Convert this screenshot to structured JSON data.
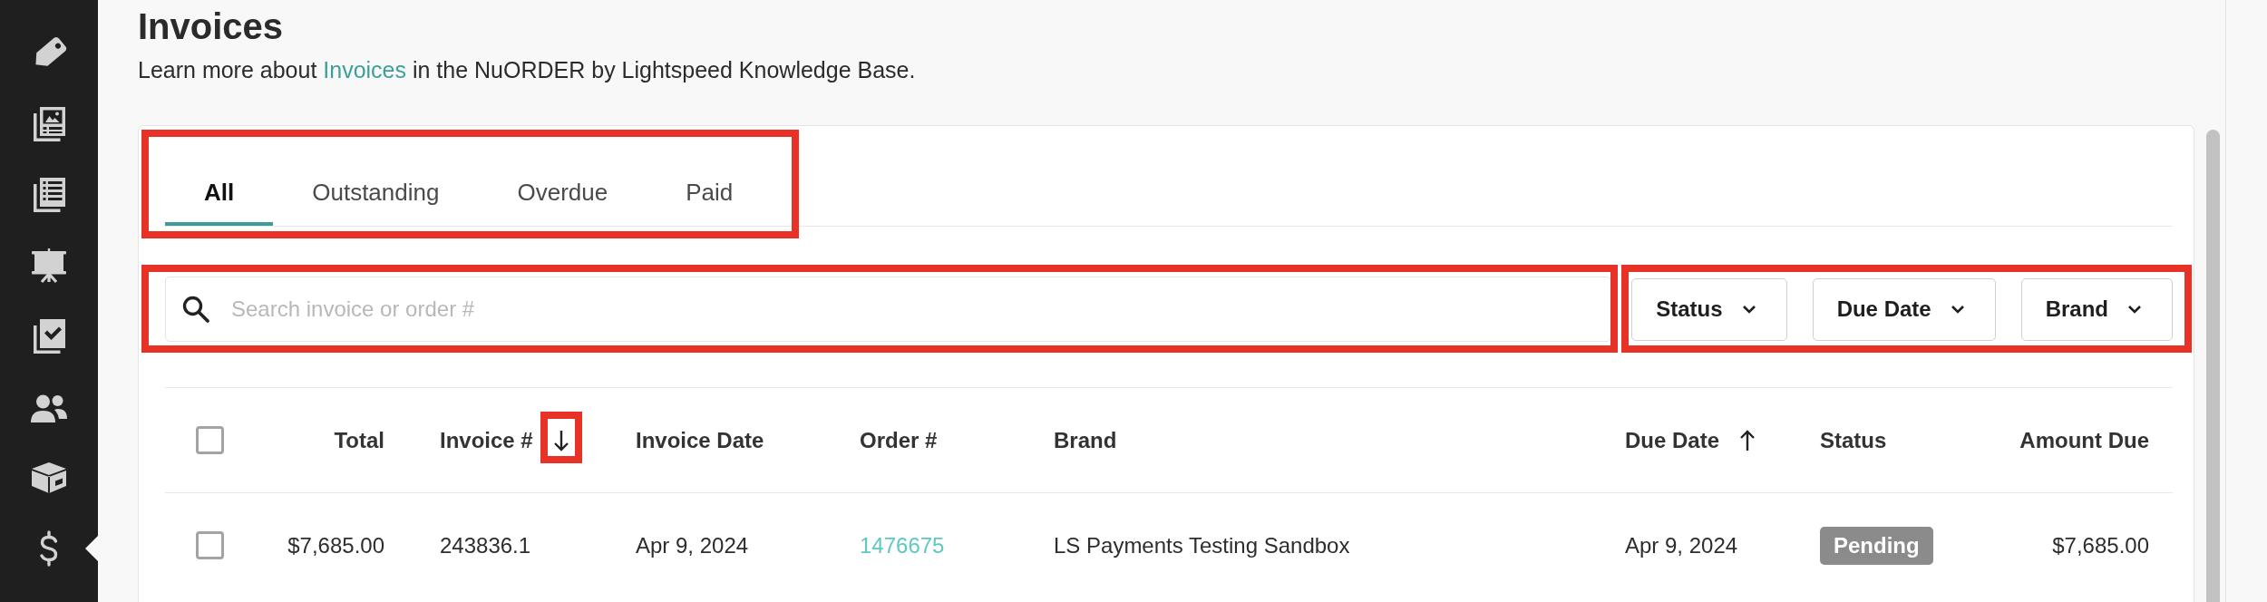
{
  "sidebar": {
    "items": [
      {
        "selected": false
      },
      {
        "selected": false
      },
      {
        "selected": false
      },
      {
        "selected": false
      },
      {
        "selected": false
      },
      {
        "selected": false
      },
      {
        "selected": false
      },
      {
        "selected": true
      }
    ]
  },
  "header": {
    "title": "Invoices",
    "help": {
      "before": "Learn more about ",
      "link": "Invoices",
      "after": " in the NuORDER by Lightspeed Knowledge Base."
    }
  },
  "tabs": {
    "highlighted": true,
    "items": [
      {
        "label": "All",
        "selected": true
      },
      {
        "label": "Outstanding",
        "selected": false
      },
      {
        "label": "Overdue",
        "selected": false
      },
      {
        "label": "Paid",
        "selected": false
      }
    ]
  },
  "search": {
    "placeholder": "Search invoice or order #",
    "highlighted": true
  },
  "filters": {
    "highlighted": true,
    "items": [
      {
        "label": "Status"
      },
      {
        "label": "Due Date"
      },
      {
        "label": "Brand"
      }
    ]
  },
  "table": {
    "select_all": {
      "checked": false
    },
    "columns": [
      {
        "label": "Total",
        "kind": "plain",
        "highlighted": false
      },
      {
        "label": "Invoice #",
        "kind": "descending",
        "highlighted": true
      },
      {
        "label": "Invoice Date",
        "kind": "plain",
        "highlighted": false
      },
      {
        "label": "Order #",
        "kind": "plain",
        "highlighted": false
      },
      {
        "label": "Brand",
        "kind": "plain",
        "highlighted": false
      },
      {
        "label": "Due Date",
        "kind": "ascending",
        "highlighted": false
      },
      {
        "label": "Status",
        "kind": "plain",
        "highlighted": false
      },
      {
        "label": "Amount Due",
        "kind": "plain",
        "highlighted": false
      }
    ],
    "rows": [
      {
        "checked": false,
        "cells": [
          {
            "kind": "text",
            "text": "$7,685.00"
          },
          {
            "kind": "text",
            "text": "243836.1"
          },
          {
            "kind": "text",
            "text": "Apr 9, 2024"
          },
          {
            "kind": "link",
            "text": "1476675"
          },
          {
            "kind": "text",
            "text": "LS Payments Testing Sandbox"
          },
          {
            "kind": "text",
            "text": "Apr 9, 2024"
          },
          {
            "kind": "badge",
            "text": "Pending"
          },
          {
            "kind": "text",
            "text": "$7,685.00"
          }
        ]
      }
    ]
  }
}
